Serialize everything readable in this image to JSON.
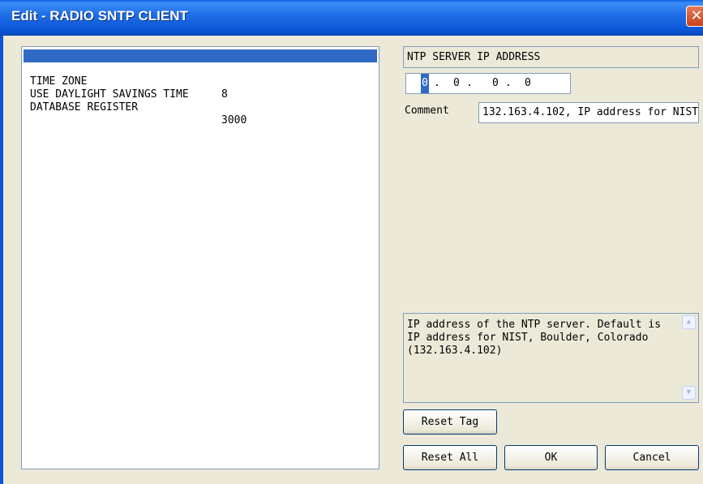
{
  "window": {
    "title": "Edit - RADIO SNTP CLIENT",
    "close_glyph": "✕"
  },
  "parameters": [
    {
      "label": "NTP SERVER IP ADDRESS",
      "value": "0.0.0.0",
      "selected": true
    },
    {
      "label": "TIME ZONE",
      "value": "8",
      "selected": false
    },
    {
      "label": "USE DAYLIGHT SAVINGS TIME",
      "value": "",
      "selected": false
    },
    {
      "label": "DATABASE REGISTER",
      "value": "3000",
      "selected": false
    }
  ],
  "editor": {
    "field_title": "NTP SERVER IP ADDRESS",
    "ip_segments": [
      "0",
      "0",
      "0",
      "0"
    ],
    "ip_separator": ".",
    "comment_label": "Comment",
    "comment_value": "132.163.4.102, IP address for NIST",
    "help_text": "IP address of the NTP server. Default is IP address for NIST, Boulder, Colorado (132.163.4.102)"
  },
  "buttons": {
    "reset_tag": "Reset Tag",
    "reset_all": "Reset All",
    "ok": "OK",
    "cancel": "Cancel"
  },
  "icons": {
    "scroll_up": "▲",
    "scroll_down": "▼"
  },
  "colors": {
    "title_bar": "#0b55d6",
    "selection": "#316ac5",
    "dialog_bg": "#ece9d8"
  }
}
